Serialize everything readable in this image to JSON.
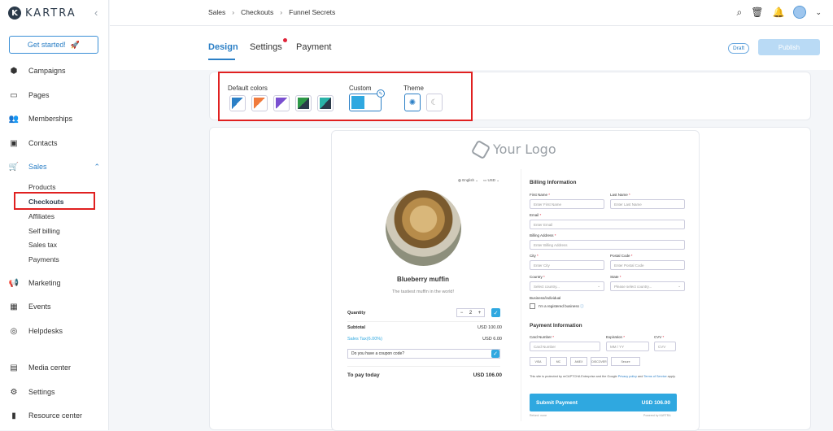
{
  "brand": {
    "name": "KARTRA",
    "mark": "K"
  },
  "sidebar": {
    "get_started": "Get started!",
    "items": [
      {
        "label": "Campaigns",
        "icon": "cube-icon"
      },
      {
        "label": "Pages",
        "icon": "pages-icon"
      },
      {
        "label": "Memberships",
        "icon": "users-icon"
      },
      {
        "label": "Contacts",
        "icon": "contact-icon"
      },
      {
        "label": "Sales",
        "icon": "cart-icon"
      },
      {
        "label": "Marketing",
        "icon": "megaphone-icon"
      },
      {
        "label": "Events",
        "icon": "calendar-icon"
      },
      {
        "label": "Helpdesks",
        "icon": "lifebuoy-icon"
      },
      {
        "label": "Media center",
        "icon": "media-icon"
      },
      {
        "label": "Settings",
        "icon": "gear-icon"
      },
      {
        "label": "Resource center",
        "icon": "book-icon"
      }
    ],
    "sales_sub": [
      "Products",
      "Checkouts",
      "Affiliates",
      "Self billing",
      "Sales tax",
      "Payments"
    ]
  },
  "breadcrumb": [
    "Sales",
    "Checkouts",
    "Funnel Secrets"
  ],
  "tabs": [
    "Design",
    "Settings",
    "Payment"
  ],
  "status": {
    "draft": "Draft",
    "publish": "Publish"
  },
  "design": {
    "default_colors_label": "Default colors",
    "custom_label": "Custom",
    "theme_label": "Theme",
    "swatches": [
      "#2b7fc6",
      "#f07a3c",
      "#7a4fd0",
      "#2e9a48",
      "#2ab3a8"
    ],
    "custom_color": "#2fa8e0"
  },
  "checkout": {
    "logo_text": "Your Logo",
    "lang": "English",
    "currency": "USD",
    "product_name": "Blueberry muffin",
    "product_desc": "The tastiest muffin in the world!",
    "quantity_label": "Quantity",
    "quantity_value": "2",
    "subtotal_label": "Subtotal",
    "subtotal_value": "USD 100.00",
    "tax_label": "Sales Tax(6.00%)",
    "tax_value": "USD 6.00",
    "coupon_placeholder": "Do you have a coupon code?",
    "total_label": "To pay today",
    "total_value": "USD 106.00",
    "billing_title": "Billing Information",
    "first_name_label": "First Name",
    "first_name_ph": "Enter First Name",
    "last_name_label": "Last Name",
    "last_name_ph": "Enter Last Name",
    "email_label": "Email",
    "email_ph": "Enter Email",
    "address_label": "Billing Address",
    "address_ph": "Enter Billing Address",
    "city_label": "City",
    "city_ph": "Enter City",
    "postal_label": "Postal Code",
    "postal_ph": "Enter Postal Code",
    "country_label": "Country",
    "country_ph": "Select country...",
    "state_label": "State",
    "state_ph": "Please select country...",
    "business_label": "Business/individual",
    "business_check": "I'm a registered business",
    "payment_title": "Payment Information",
    "card_label": "Card Number",
    "card_ph": "Card Number",
    "exp_label": "Expiration",
    "exp_ph": "MM / YY",
    "cvv_label": "CVV",
    "cvv_ph": "CVV",
    "card_brands": [
      "VISA",
      "MC",
      "AMEX",
      "DISCOVER",
      "Secure"
    ],
    "recaptcha_pre": "This site is protected by reCAPTCHA Enterprise and the Google",
    "privacy": "Privacy policy",
    "and": "and",
    "terms": "Terms of Service",
    "apply": "apply.",
    "submit_label": "Submit Payment",
    "submit_value": "USD 106.00",
    "refund": "Refund: none",
    "powered": "Powered by KARTRA"
  }
}
